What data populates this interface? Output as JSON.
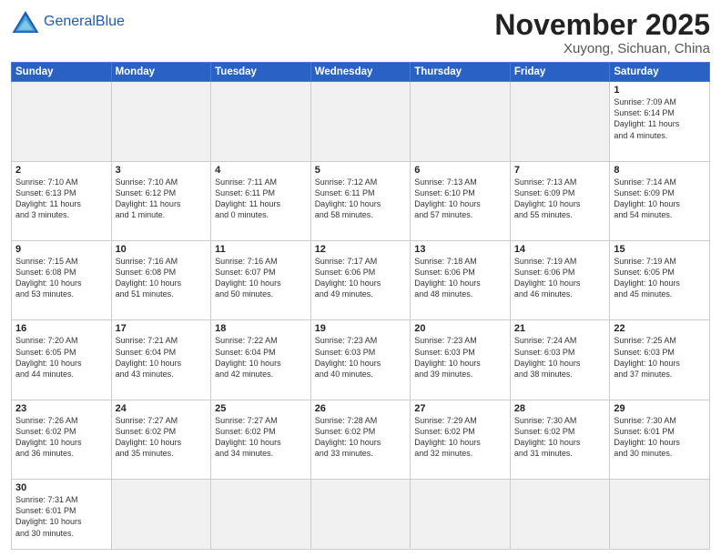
{
  "header": {
    "logo_general": "General",
    "logo_blue": "Blue",
    "month_title": "November 2025",
    "location": "Xuyong, Sichuan, China"
  },
  "weekdays": [
    "Sunday",
    "Monday",
    "Tuesday",
    "Wednesday",
    "Thursday",
    "Friday",
    "Saturday"
  ],
  "weeks": [
    [
      {
        "day": "",
        "info": ""
      },
      {
        "day": "",
        "info": ""
      },
      {
        "day": "",
        "info": ""
      },
      {
        "day": "",
        "info": ""
      },
      {
        "day": "",
        "info": ""
      },
      {
        "day": "",
        "info": ""
      },
      {
        "day": "1",
        "info": "Sunrise: 7:09 AM\nSunset: 6:14 PM\nDaylight: 11 hours\nand 4 minutes."
      }
    ],
    [
      {
        "day": "2",
        "info": "Sunrise: 7:10 AM\nSunset: 6:13 PM\nDaylight: 11 hours\nand 3 minutes."
      },
      {
        "day": "3",
        "info": "Sunrise: 7:10 AM\nSunset: 6:12 PM\nDaylight: 11 hours\nand 1 minute."
      },
      {
        "day": "4",
        "info": "Sunrise: 7:11 AM\nSunset: 6:11 PM\nDaylight: 11 hours\nand 0 minutes."
      },
      {
        "day": "5",
        "info": "Sunrise: 7:12 AM\nSunset: 6:11 PM\nDaylight: 10 hours\nand 58 minutes."
      },
      {
        "day": "6",
        "info": "Sunrise: 7:13 AM\nSunset: 6:10 PM\nDaylight: 10 hours\nand 57 minutes."
      },
      {
        "day": "7",
        "info": "Sunrise: 7:13 AM\nSunset: 6:09 PM\nDaylight: 10 hours\nand 55 minutes."
      },
      {
        "day": "8",
        "info": "Sunrise: 7:14 AM\nSunset: 6:09 PM\nDaylight: 10 hours\nand 54 minutes."
      }
    ],
    [
      {
        "day": "9",
        "info": "Sunrise: 7:15 AM\nSunset: 6:08 PM\nDaylight: 10 hours\nand 53 minutes."
      },
      {
        "day": "10",
        "info": "Sunrise: 7:16 AM\nSunset: 6:08 PM\nDaylight: 10 hours\nand 51 minutes."
      },
      {
        "day": "11",
        "info": "Sunrise: 7:16 AM\nSunset: 6:07 PM\nDaylight: 10 hours\nand 50 minutes."
      },
      {
        "day": "12",
        "info": "Sunrise: 7:17 AM\nSunset: 6:06 PM\nDaylight: 10 hours\nand 49 minutes."
      },
      {
        "day": "13",
        "info": "Sunrise: 7:18 AM\nSunset: 6:06 PM\nDaylight: 10 hours\nand 48 minutes."
      },
      {
        "day": "14",
        "info": "Sunrise: 7:19 AM\nSunset: 6:06 PM\nDaylight: 10 hours\nand 46 minutes."
      },
      {
        "day": "15",
        "info": "Sunrise: 7:19 AM\nSunset: 6:05 PM\nDaylight: 10 hours\nand 45 minutes."
      }
    ],
    [
      {
        "day": "16",
        "info": "Sunrise: 7:20 AM\nSunset: 6:05 PM\nDaylight: 10 hours\nand 44 minutes."
      },
      {
        "day": "17",
        "info": "Sunrise: 7:21 AM\nSunset: 6:04 PM\nDaylight: 10 hours\nand 43 minutes."
      },
      {
        "day": "18",
        "info": "Sunrise: 7:22 AM\nSunset: 6:04 PM\nDaylight: 10 hours\nand 42 minutes."
      },
      {
        "day": "19",
        "info": "Sunrise: 7:23 AM\nSunset: 6:03 PM\nDaylight: 10 hours\nand 40 minutes."
      },
      {
        "day": "20",
        "info": "Sunrise: 7:23 AM\nSunset: 6:03 PM\nDaylight: 10 hours\nand 39 minutes."
      },
      {
        "day": "21",
        "info": "Sunrise: 7:24 AM\nSunset: 6:03 PM\nDaylight: 10 hours\nand 38 minutes."
      },
      {
        "day": "22",
        "info": "Sunrise: 7:25 AM\nSunset: 6:03 PM\nDaylight: 10 hours\nand 37 minutes."
      }
    ],
    [
      {
        "day": "23",
        "info": "Sunrise: 7:26 AM\nSunset: 6:02 PM\nDaylight: 10 hours\nand 36 minutes."
      },
      {
        "day": "24",
        "info": "Sunrise: 7:27 AM\nSunset: 6:02 PM\nDaylight: 10 hours\nand 35 minutes."
      },
      {
        "day": "25",
        "info": "Sunrise: 7:27 AM\nSunset: 6:02 PM\nDaylight: 10 hours\nand 34 minutes."
      },
      {
        "day": "26",
        "info": "Sunrise: 7:28 AM\nSunset: 6:02 PM\nDaylight: 10 hours\nand 33 minutes."
      },
      {
        "day": "27",
        "info": "Sunrise: 7:29 AM\nSunset: 6:02 PM\nDaylight: 10 hours\nand 32 minutes."
      },
      {
        "day": "28",
        "info": "Sunrise: 7:30 AM\nSunset: 6:02 PM\nDaylight: 10 hours\nand 31 minutes."
      },
      {
        "day": "29",
        "info": "Sunrise: 7:30 AM\nSunset: 6:01 PM\nDaylight: 10 hours\nand 30 minutes."
      }
    ],
    [
      {
        "day": "30",
        "info": "Sunrise: 7:31 AM\nSunset: 6:01 PM\nDaylight: 10 hours\nand 30 minutes."
      },
      {
        "day": "",
        "info": ""
      },
      {
        "day": "",
        "info": ""
      },
      {
        "day": "",
        "info": ""
      },
      {
        "day": "",
        "info": ""
      },
      {
        "day": "",
        "info": ""
      },
      {
        "day": "",
        "info": ""
      }
    ]
  ]
}
